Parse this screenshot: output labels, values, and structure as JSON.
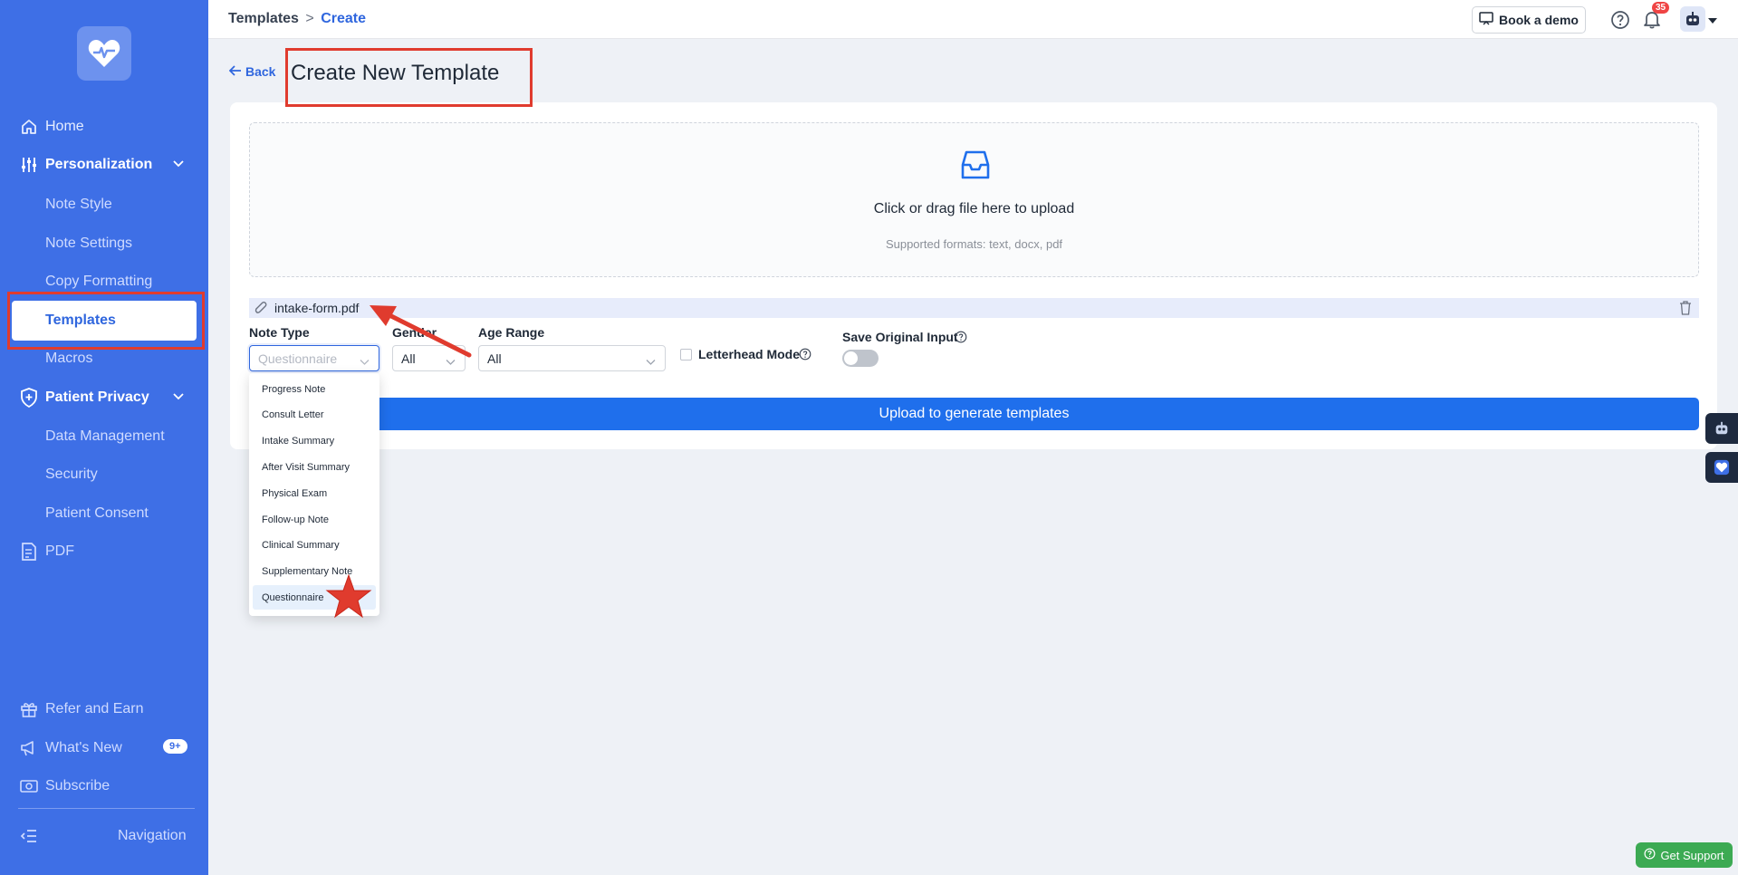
{
  "sidebar": {
    "home": "Home",
    "personalization": "Personalization",
    "note_style": "Note Style",
    "note_settings": "Note Settings",
    "copy_formatting": "Copy Formatting",
    "templates": "Templates",
    "macros": "Macros",
    "patient_privacy": "Patient Privacy",
    "data_management": "Data Management",
    "security": "Security",
    "patient_consent": "Patient Consent",
    "pdf": "PDF",
    "refer_and_earn": "Refer and Earn",
    "whats_new": "What's New",
    "whats_new_badge": "9+",
    "subscribe": "Subscribe",
    "navigation": "Navigation"
  },
  "topbar": {
    "breadcrumb_parent": "Templates",
    "breadcrumb_sep": ">",
    "breadcrumb_current": "Create",
    "book_demo": "Book a demo",
    "notification_count": "35"
  },
  "page": {
    "back": "Back",
    "title": "Create New Template"
  },
  "upload": {
    "main_text": "Click or drag file here to upload",
    "sub_text": "Supported formats: text, docx, pdf",
    "file_name": "intake-form.pdf",
    "button": "Upload to generate templates"
  },
  "form": {
    "note_type_label": "Note Type",
    "note_type_value": "Questionnaire",
    "gender_label": "Gender",
    "gender_value": "All",
    "age_range_label": "Age Range",
    "age_range_value": "All",
    "letterhead_label": "Letterhead Mode",
    "save_original_label": "Save Original Input"
  },
  "note_type_options": [
    "Progress Note",
    "Consult Letter",
    "Intake Summary",
    "After Visit Summary",
    "Physical Exam",
    "Follow-up Note",
    "Clinical Summary",
    "Supplementary Note",
    "Questionnaire"
  ],
  "support": {
    "label": "Get Support"
  },
  "colors": {
    "sidebar": "#3e6fe6",
    "accent": "#1f6fec",
    "annotation": "#e03b2e",
    "support": "#3caa53"
  }
}
